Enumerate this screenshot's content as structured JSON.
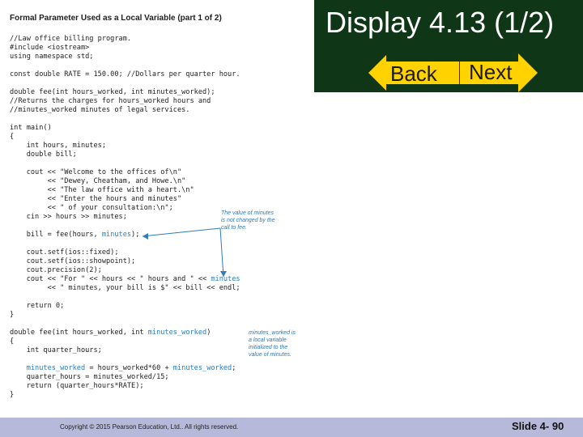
{
  "slide": {
    "title": "Display 4.13 (1/2)",
    "nav": {
      "back_label": "Back",
      "next_label": "Next",
      "arrow_color": "#ffd200"
    },
    "panel_color": "#0f3617"
  },
  "code_header": "Formal Parameter Used as a Local Variable (part 1 of 2)",
  "code_lines": [
    {
      "segments": [
        {
          "text": "//Law office billing program."
        }
      ]
    },
    {
      "segments": [
        {
          "text": "#include <iostream>"
        }
      ]
    },
    {
      "segments": [
        {
          "text": "using namespace std;"
        }
      ]
    },
    {
      "segments": [
        {
          "text": ""
        }
      ]
    },
    {
      "segments": [
        {
          "text": "const double RATE = 150.00; //Dollars per quarter hour."
        }
      ]
    },
    {
      "segments": [
        {
          "text": ""
        }
      ]
    },
    {
      "segments": [
        {
          "text": "double fee(int hours_worked, int minutes_worked);"
        }
      ]
    },
    {
      "segments": [
        {
          "text": "//Returns the charges for hours_worked hours and"
        }
      ]
    },
    {
      "segments": [
        {
          "text": "//minutes_worked minutes of legal services."
        }
      ]
    },
    {
      "segments": [
        {
          "text": ""
        }
      ]
    },
    {
      "segments": [
        {
          "text": "int main()"
        }
      ]
    },
    {
      "segments": [
        {
          "text": "{"
        }
      ]
    },
    {
      "segments": [
        {
          "text": "    int hours, minutes;"
        }
      ]
    },
    {
      "segments": [
        {
          "text": "    double bill;"
        }
      ]
    },
    {
      "segments": [
        {
          "text": ""
        }
      ]
    },
    {
      "segments": [
        {
          "text": "    cout << \"Welcome to the offices of\\n\""
        }
      ]
    },
    {
      "segments": [
        {
          "text": "         << \"Dewey, Cheatham, and Howe.\\n\""
        }
      ]
    },
    {
      "segments": [
        {
          "text": "         << \"The law office with a heart.\\n\""
        }
      ]
    },
    {
      "segments": [
        {
          "text": "         << \"Enter the hours and minutes\""
        }
      ]
    },
    {
      "segments": [
        {
          "text": "         << \" of your consultation:\\n\";"
        }
      ]
    },
    {
      "segments": [
        {
          "text": "    cin >> hours >> minutes;"
        }
      ]
    },
    {
      "segments": [
        {
          "text": ""
        }
      ]
    },
    {
      "segments": [
        {
          "text": "    bill = fee(hours, "
        },
        {
          "text": "minutes",
          "hl": true
        },
        {
          "text": ");"
        }
      ]
    },
    {
      "segments": [
        {
          "text": ""
        }
      ]
    },
    {
      "segments": [
        {
          "text": "    cout.setf(ios::fixed);"
        }
      ]
    },
    {
      "segments": [
        {
          "text": "    cout.setf(ios::showpoint);"
        }
      ]
    },
    {
      "segments": [
        {
          "text": "    cout.precision(2);"
        }
      ]
    },
    {
      "segments": [
        {
          "text": "    cout << \"For \" << hours << \" hours and \" << "
        },
        {
          "text": "minutes",
          "hl": true
        }
      ]
    },
    {
      "segments": [
        {
          "text": "         << \" minutes, your bill is $\" << bill << endl;"
        }
      ]
    },
    {
      "segments": [
        {
          "text": ""
        }
      ]
    },
    {
      "segments": [
        {
          "text": "    return 0;"
        }
      ]
    },
    {
      "segments": [
        {
          "text": "}"
        }
      ]
    },
    {
      "segments": [
        {
          "text": ""
        }
      ]
    },
    {
      "segments": [
        {
          "text": "double fee(int hours_worked, int "
        },
        {
          "text": "minutes_worked",
          "hl": true
        },
        {
          "text": ")"
        }
      ]
    },
    {
      "segments": [
        {
          "text": "{"
        }
      ]
    },
    {
      "segments": [
        {
          "text": "    int quarter_hours;"
        }
      ]
    },
    {
      "segments": [
        {
          "text": ""
        }
      ]
    },
    {
      "segments": [
        {
          "text": "    "
        },
        {
          "text": "minutes_worked",
          "hl": true
        },
        {
          "text": " = hours_worked*60 + "
        },
        {
          "text": "minutes_worked",
          "hl": true
        },
        {
          "text": ";"
        }
      ]
    },
    {
      "segments": [
        {
          "text": "    quarter_hours = minutes_worked/15;"
        }
      ]
    },
    {
      "segments": [
        {
          "text": "    return (quarter_hours*RATE);"
        }
      ]
    },
    {
      "segments": [
        {
          "text": "}"
        }
      ]
    }
  ],
  "annotations": {
    "minutes_note": [
      "The value of minutes",
      "is not changed by the",
      "call to fee."
    ],
    "local_note": [
      "minutes_worked is",
      "a local variable",
      "initialized to the",
      "value of minutes."
    ]
  },
  "footer": {
    "copyright": "Copyright © 2015 Pearson Education, Ltd.. All rights reserved.",
    "slide_number": "Slide 4- 90",
    "bar_color": "#b7b9da"
  }
}
